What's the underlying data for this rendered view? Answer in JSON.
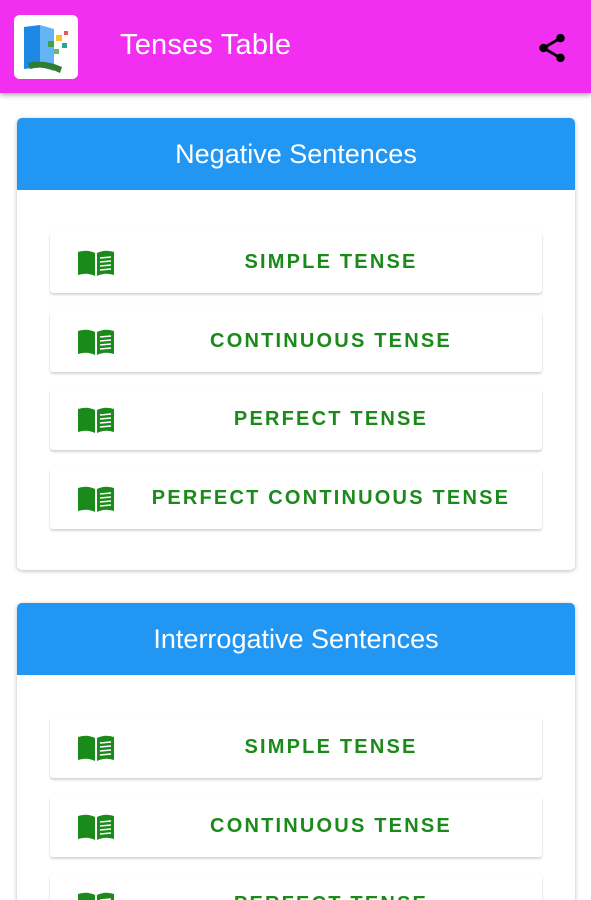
{
  "appbar": {
    "title": "Tenses Table",
    "share_icon": "share-icon",
    "logo_icon": "app-logo-icon",
    "color": "#f22ff0"
  },
  "colors": {
    "card_header": "#2196f3",
    "button_text": "#1a8a1a"
  },
  "sections": [
    {
      "title": "Negative Sentences",
      "items": [
        {
          "label": "SIMPLE TENSE",
          "icon": "open-book-icon"
        },
        {
          "label": "CONTINUOUS TENSE",
          "icon": "open-book-icon"
        },
        {
          "label": "PERFECT TENSE",
          "icon": "open-book-icon"
        },
        {
          "label": "PERFECT CONTINUOUS TENSE",
          "icon": "open-book-icon"
        }
      ]
    },
    {
      "title": "Interrogative Sentences",
      "items": [
        {
          "label": "SIMPLE TENSE",
          "icon": "open-book-icon"
        },
        {
          "label": "CONTINUOUS TENSE",
          "icon": "open-book-icon"
        },
        {
          "label": "PERFECT TENSE",
          "icon": "open-book-icon"
        }
      ]
    }
  ]
}
